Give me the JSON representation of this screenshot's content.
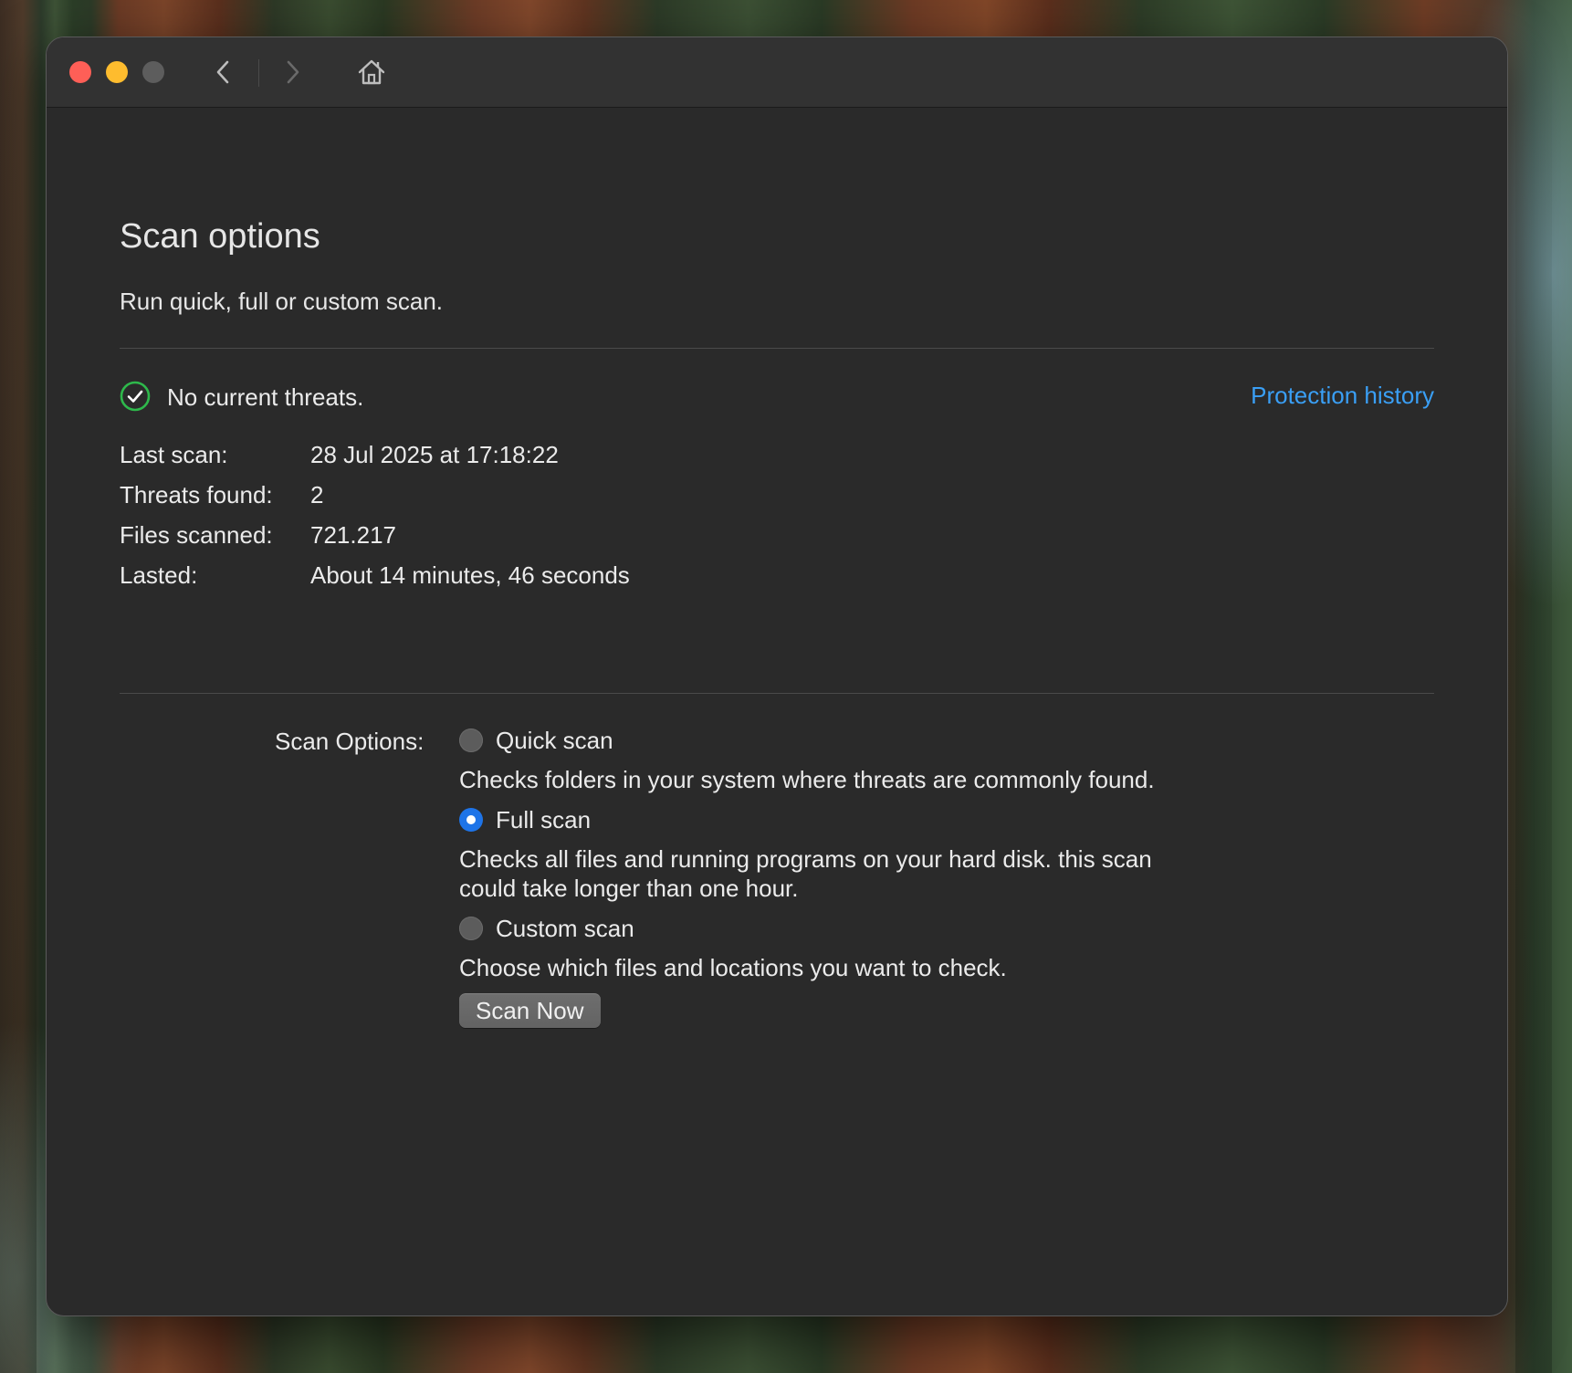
{
  "window": {
    "title": "Scan options",
    "subtitle": "Run quick, full or custom scan."
  },
  "toolbar": {
    "back_icon": "chevron-left-icon",
    "forward_icon": "chevron-right-icon",
    "home_icon": "home-icon"
  },
  "status": {
    "icon": "check-circle-icon",
    "text": "No current threats.",
    "history_link": "Protection history"
  },
  "stats": [
    {
      "label": "Last scan:",
      "value": "28 Jul 2025 at 17:18:22"
    },
    {
      "label": "Threats found:",
      "value": "2"
    },
    {
      "label": "Files scanned:",
      "value": "721.217"
    },
    {
      "label": "Lasted:",
      "value": "About 14 minutes, 46 seconds"
    }
  ],
  "scan_options": {
    "label": "Scan Options:",
    "items": [
      {
        "label": "Quick scan",
        "description": "Checks folders in your system where threats are commonly found.",
        "selected": false
      },
      {
        "label": "Full scan",
        "description": "Checks all files and running programs on your hard disk. this scan could take longer than one hour.",
        "selected": true
      },
      {
        "label": "Custom scan",
        "description": "Choose which files and locations you want to check.",
        "selected": false
      }
    ],
    "button_label": "Scan Now"
  },
  "colors": {
    "window_bg": "#2a2a2a",
    "titlebar_bg": "#323232",
    "link": "#3a9ff5",
    "success": "#2eb84b",
    "radio_selected": "#1e74e8",
    "close": "#fe5f57",
    "minimize": "#febc2e",
    "zoom_disabled": "#5d5d5d"
  }
}
